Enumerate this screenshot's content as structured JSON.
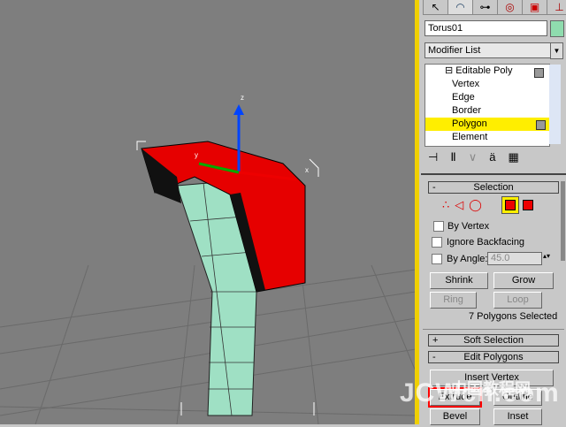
{
  "tabs": [
    {
      "icon": "create-icon"
    },
    {
      "icon": "modify-icon"
    },
    {
      "icon": "hierarchy-icon"
    },
    {
      "icon": "motion-icon"
    },
    {
      "icon": "display-icon"
    },
    {
      "icon": "utilities-icon"
    }
  ],
  "object_name": "Torus01",
  "object_color": "#8fdcae",
  "modifier_list": "Modifier List",
  "stack": {
    "root": "Editable Poly",
    "items": [
      "Vertex",
      "Edge",
      "Border",
      "Polygon",
      "Element"
    ],
    "selected": "Polygon"
  },
  "selection": {
    "title": "Selection",
    "by_vertex": "By Vertex",
    "ignore_backfacing": "Ignore Backfacing",
    "by_angle": "By Angle:",
    "angle_value": "45.0",
    "shrink": "Shrink",
    "grow": "Grow",
    "ring": "Ring",
    "loop": "Loop",
    "status": "7 Polygons Selected"
  },
  "soft_selection": {
    "title": "Soft Selection",
    "toggle": "+"
  },
  "edit_polygons": {
    "title": "Edit Polygons",
    "toggle": "-",
    "insert_vertex": "Insert Vertex",
    "extrude": "Extrude",
    "outline": "Outline",
    "bevel": "Bevel",
    "inset": "Inset"
  },
  "viewport": {
    "axis_x": "x",
    "axis_y": "y",
    "axis_z": "z"
  },
  "watermark": {
    "text": "JCWcn.com",
    "cn": "中国教程网"
  }
}
